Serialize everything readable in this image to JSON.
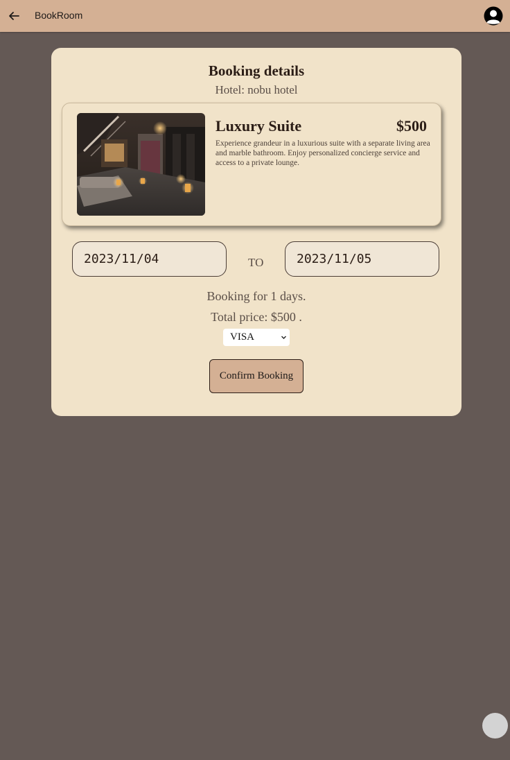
{
  "app": {
    "title": "BookRoom",
    "icons": {
      "back": "arrow-left-icon",
      "account": "account-circle-icon"
    }
  },
  "booking": {
    "heading": "Booking details",
    "hotel_label": "Hotel: nobu hotel",
    "room": {
      "name": "Luxury Suite",
      "price": "$500",
      "description": "Experience grandeur in a luxurious suite with a separate living area and marble bathroom. Enjoy personalized concierge service and access to a private lounge."
    },
    "date_from": "2023/11/04",
    "to_label": "TO",
    "date_to": "2023/11/05",
    "days_text": "Booking for 1 days.",
    "total_text": "Total price: $500 .",
    "payment_selected": "VISA",
    "confirm_label": "Confirm Booking"
  },
  "colors": {
    "background": "#645955",
    "topbar": "#d4b094",
    "panel": "#f1e3c9",
    "text_dark": "#2b1d16"
  }
}
